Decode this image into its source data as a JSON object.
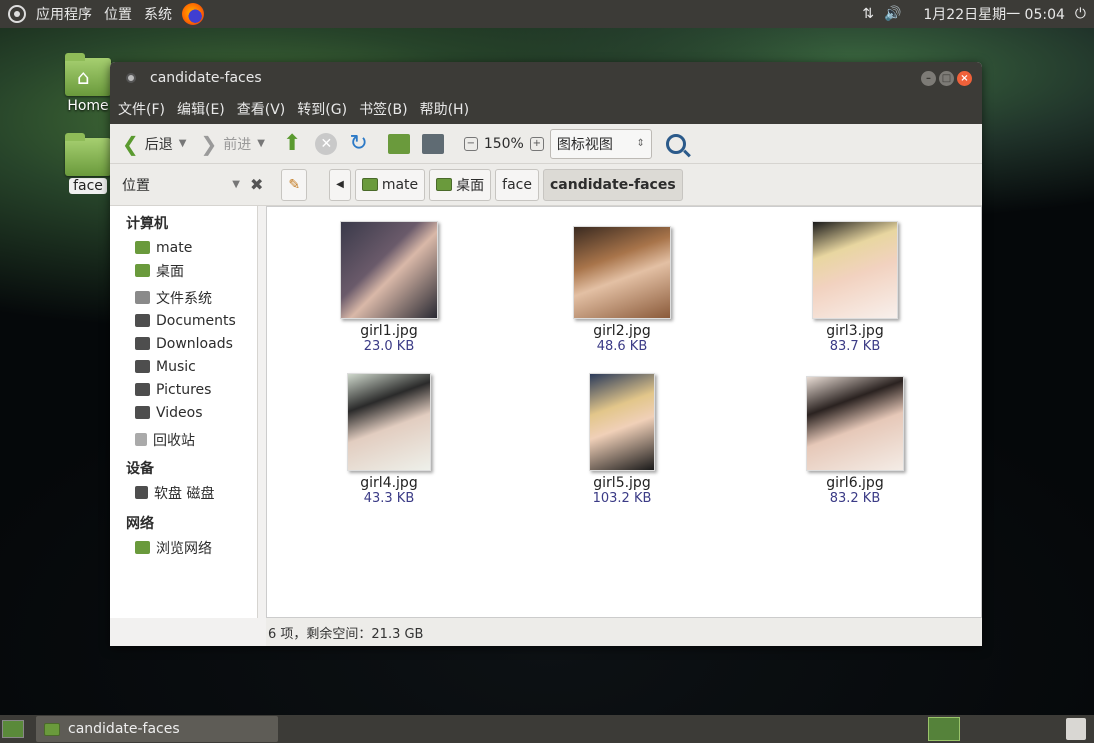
{
  "top_panel": {
    "menus": [
      "应用程序",
      "位置",
      "系统"
    ],
    "clock": "1月22日星期一 05:04",
    "tray_icons": [
      "network-icon",
      "volume-icon",
      "power-icon"
    ]
  },
  "desktop": {
    "icons": [
      {
        "label": "Home",
        "icon": "home-folder-icon"
      },
      {
        "label": "face",
        "icon": "folder-icon",
        "selected": true
      }
    ]
  },
  "window": {
    "title": "candidate-faces",
    "menubar": [
      "文件(F)",
      "编辑(E)",
      "查看(V)",
      "转到(G)",
      "书签(B)",
      "帮助(H)"
    ],
    "toolbar": {
      "back": "后退",
      "forward": "前进",
      "zoom": "150%",
      "view_mode": "图标视图"
    },
    "location": {
      "places_label": "位置",
      "breadcrumbs": [
        "mate",
        "桌面",
        "face",
        "candidate-faces"
      ]
    },
    "sidebar": {
      "sections": [
        {
          "title": "计算机",
          "items": [
            "mate",
            "桌面",
            "文件系统",
            "Documents",
            "Downloads",
            "Music",
            "Pictures",
            "Videos",
            "回收站"
          ]
        },
        {
          "title": "设备",
          "items": [
            "软盘 磁盘"
          ]
        },
        {
          "title": "网络",
          "items": [
            "浏览网络"
          ]
        }
      ]
    },
    "files": [
      {
        "name": "girl1.jpg",
        "size": "23.0 KB"
      },
      {
        "name": "girl2.jpg",
        "size": "48.6 KB"
      },
      {
        "name": "girl3.jpg",
        "size": "83.7 KB"
      },
      {
        "name": "girl4.jpg",
        "size": "43.3 KB"
      },
      {
        "name": "girl5.jpg",
        "size": "103.2 KB"
      },
      {
        "name": "girl6.jpg",
        "size": "83.2 KB"
      }
    ],
    "status": "6 项，剩余空间：21.3 GB"
  },
  "bottom_panel": {
    "task": "candidate-faces"
  }
}
